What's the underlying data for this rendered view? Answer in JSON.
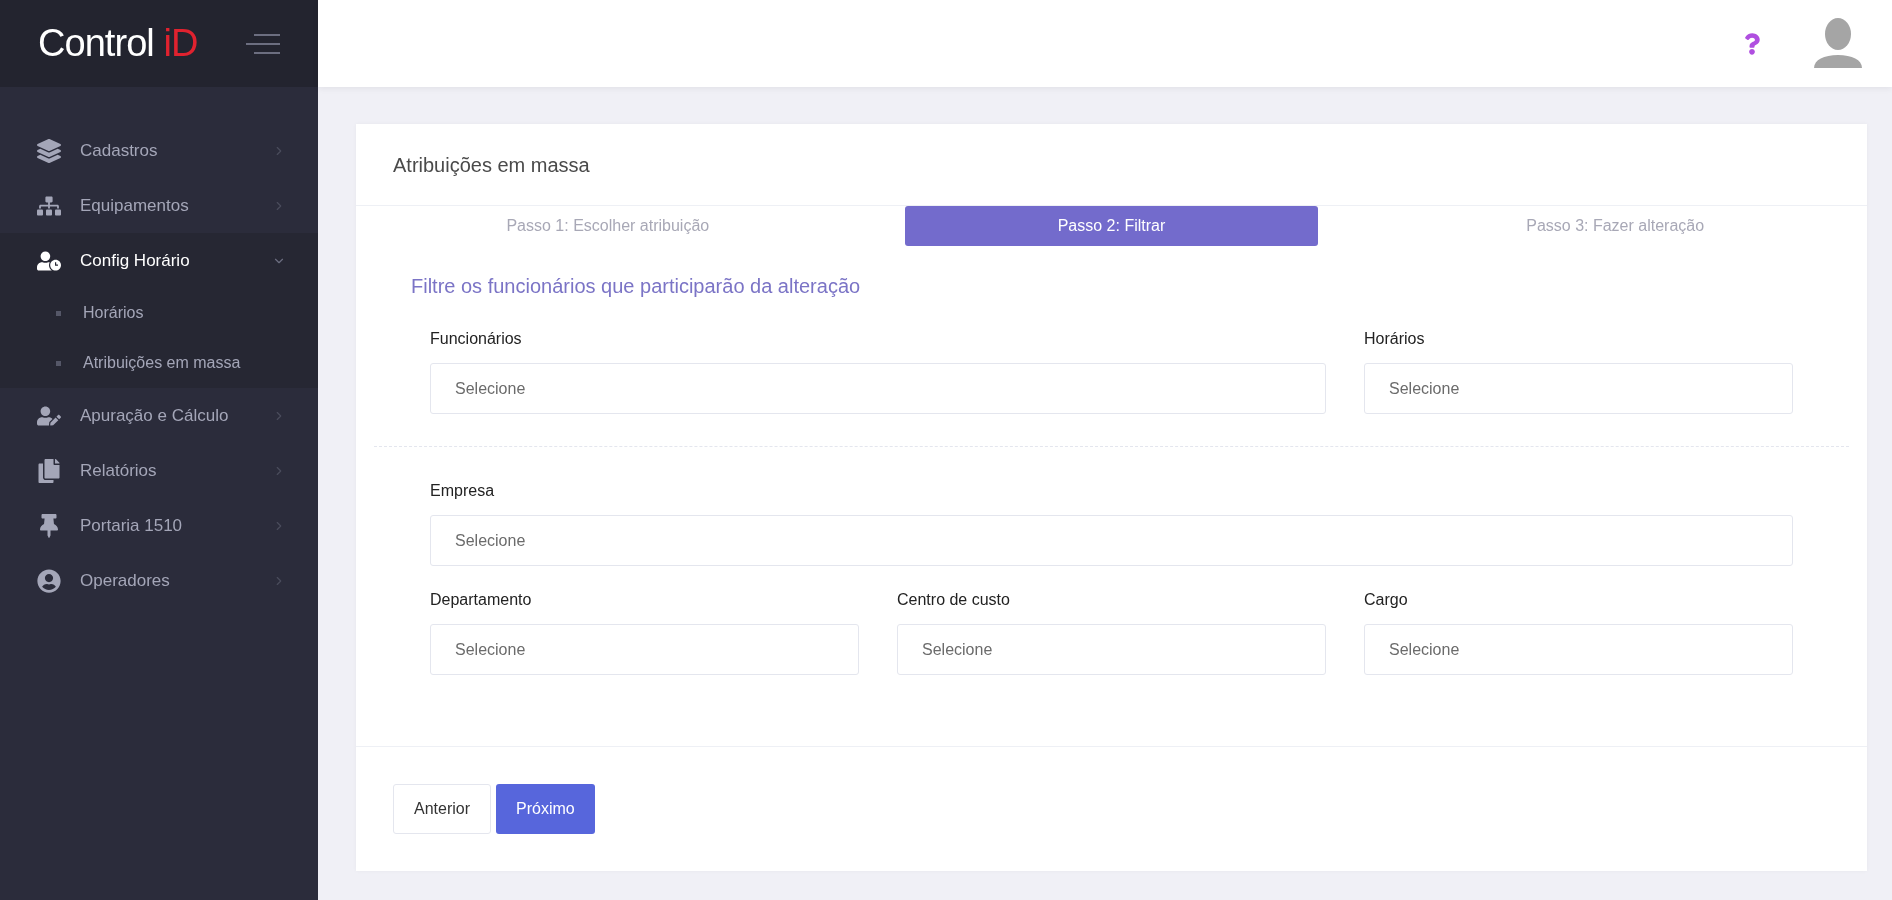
{
  "logo": {
    "text": "Control",
    "accent": "iD"
  },
  "sidebar": {
    "items": [
      {
        "label": "Cadastros",
        "expanded": false
      },
      {
        "label": "Equipamentos",
        "expanded": false
      },
      {
        "label": "Config Horário",
        "expanded": true,
        "children": [
          {
            "label": "Horários"
          },
          {
            "label": "Atribuições em massa"
          }
        ]
      },
      {
        "label": "Apuração e Cálculo",
        "expanded": false
      },
      {
        "label": "Relatórios",
        "expanded": false
      },
      {
        "label": "Portaria 1510",
        "expanded": false
      },
      {
        "label": "Operadores",
        "expanded": false
      }
    ]
  },
  "card": {
    "title": "Atribuições em massa",
    "steps": [
      {
        "label": "Passo 1: Escolher atribuição",
        "selected": false
      },
      {
        "label": "Passo 2: Filtrar",
        "selected": true
      },
      {
        "label": "Passo 3: Fazer alteração",
        "selected": false
      }
    ],
    "subtitle": "Filtre os funcionários que participarão da alteração",
    "sections": [
      {
        "rows": [
          [
            {
              "label": "Funcionários",
              "placeholder": "Selecione"
            },
            {
              "label": "Horários",
              "placeholder": "Selecione"
            }
          ]
        ]
      },
      {
        "rows": [
          [
            {
              "label": "Empresa",
              "placeholder": "Selecione"
            }
          ],
          [
            {
              "label": "Departamento",
              "placeholder": "Selecione"
            },
            {
              "label": "Centro de custo",
              "placeholder": "Selecione"
            },
            {
              "label": "Cargo",
              "placeholder": "Selecione"
            }
          ]
        ]
      }
    ],
    "buttons": [
      {
        "label": "Anterior",
        "kind": "secondary"
      },
      {
        "label": "Próximo",
        "kind": "primary"
      }
    ]
  }
}
